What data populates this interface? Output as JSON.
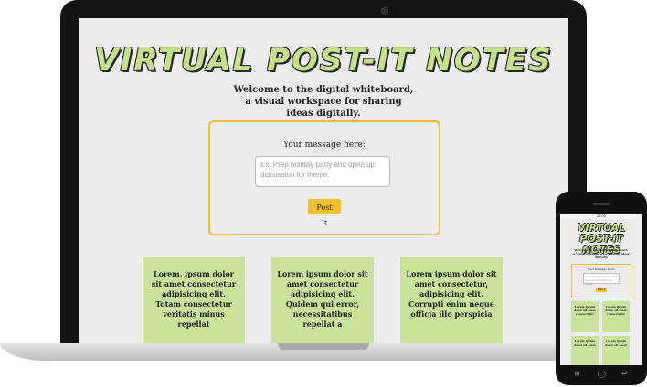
{
  "page": {
    "title": "VIRTUAL POST-IT NOTES",
    "intro": "Welcome to the digital whiteboard, a visual workspace for sharing ideas digitally.",
    "form": {
      "label": "Your message here:",
      "placeholder": "Ex. Prep holiday party and open up discussion for theme.",
      "button": "Post It"
    },
    "notes": [
      {
        "text": "Lorem, ipsum dolor sit amet consectetur adipisicing elit. Totam consectetur veritatis minus repellat"
      },
      {
        "text": "Lorem ipsum dolor sit amet consectetur adipisicing elit. Quidem qui error, necessitatibus repellat a"
      },
      {
        "text": "Lorem ipsum dolor sit amet consectetur, adipisicing elit. Corrupti enim neque officia illo perspicia"
      }
    ]
  },
  "phone": {
    "status_time": "12:00",
    "title": "VIRTUAL POST-IT NOTES",
    "intro": "Welcome to the digital whiteboard, a visual workspace for sharing ideas digitally.",
    "form": {
      "label": "Your message here:",
      "placeholder": "Ex. Prep holiday party and open up discussion for theme.",
      "button": "Post It"
    },
    "notes": [
      {
        "text": "Lorem ipsum dolor sit amet consectetur"
      },
      {
        "text": "Lorem ipsum dolor sit amet consectetur"
      },
      {
        "text": "Lorem ipsum dolor sit amet"
      },
      {
        "text": "Lorem ipsum dolor sit amet"
      }
    ]
  },
  "colors": {
    "note_green": "#c9e39a",
    "accent_yellow": "#f2c02a",
    "background": "#ececec"
  },
  "icons": [
    "camera-icon",
    "back-icon",
    "home-icon",
    "recent-apps-icon"
  ]
}
